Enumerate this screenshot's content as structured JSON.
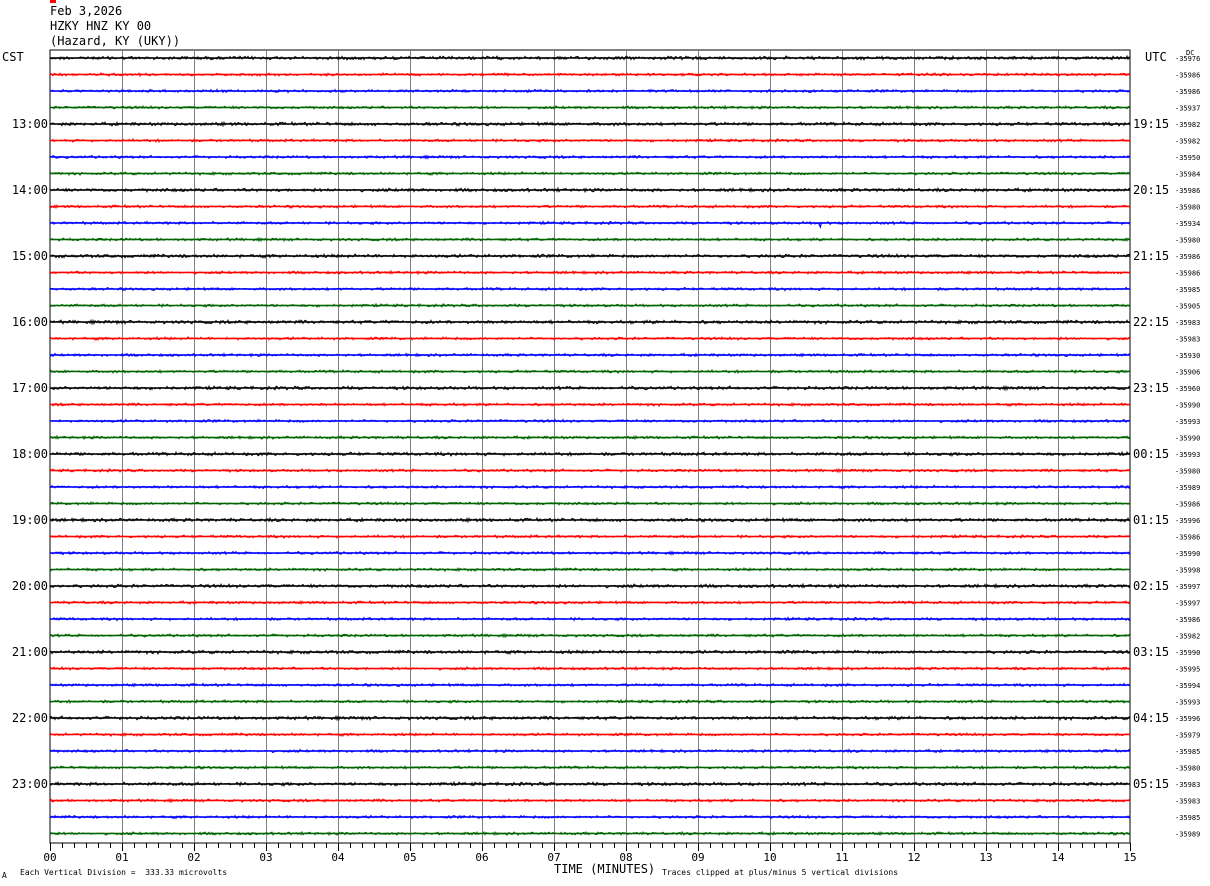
{
  "header": {
    "date": "Feb 3,2026",
    "station": "HZKY HNZ KY 00",
    "location": "(Hazard, KY (UKY))"
  },
  "labels": {
    "left_tz": "CST",
    "right_tz": "UTC",
    "dc": "DC",
    "xlabel": "TIME (MINUTES)",
    "scale_note": "Each Vertical Division =  333.33 microvolts",
    "clip_note": "Traces clipped at plus/minus 5 vertical divisions",
    "corner_mark": "A"
  },
  "colors": {
    "cycle": [
      "#000000",
      "#ff0000",
      "#0000ff",
      "#006400"
    ],
    "grid": "#808080",
    "frame": "#000000"
  },
  "chart_data": {
    "type": "line",
    "x_ticks": [
      "00",
      "01",
      "02",
      "03",
      "04",
      "05",
      "06",
      "07",
      "08",
      "09",
      "10",
      "11",
      "12",
      "13",
      "14",
      "15"
    ],
    "xlim": [
      0,
      15
    ],
    "rows": 48,
    "left_hours": [
      "13:00",
      "14:00",
      "15:00",
      "16:00",
      "17:00",
      "18:00",
      "19:00",
      "20:00",
      "21:00",
      "22:00",
      "23:00"
    ],
    "right_hours": [
      "19:15",
      "20:15",
      "21:15",
      "22:15",
      "23:15",
      "00:15",
      "01:15",
      "02:15",
      "03:15",
      "04:15",
      "05:15"
    ],
    "dc_offsets": [
      "-35976",
      "-35986",
      "-35986",
      "-35937",
      "-35982",
      "-35982",
      "-35950",
      "-35984",
      "-35986",
      "-35980",
      "-35934",
      "-35980",
      "-35986",
      "-35986",
      "-35985",
      "-35905",
      "-35983",
      "-35983",
      "-35930",
      "-35906",
      "-35960",
      "-35990",
      "-35993",
      "-35990",
      "-35993",
      "-35980",
      "-35989",
      "-35986",
      "-35996",
      "-35986",
      "-35990",
      "-35998",
      "-35997",
      "-35997",
      "-35986",
      "-35982",
      "-35990",
      "-35995",
      "-35994",
      "-35993",
      "-35996",
      "-35979",
      "-35985",
      "-35980",
      "-35983",
      "-35983",
      "-35985",
      "-35989"
    ],
    "events": [
      {
        "row": 10,
        "minute": 10.7,
        "amplitude": 4
      }
    ]
  }
}
